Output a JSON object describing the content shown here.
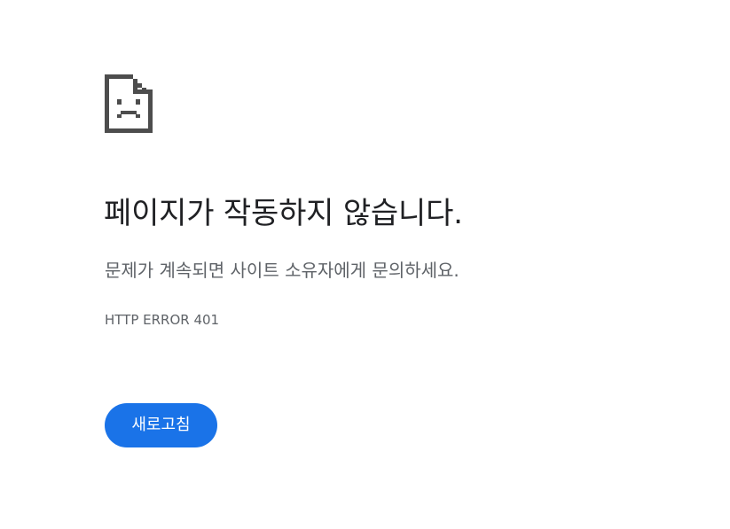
{
  "error_page": {
    "icon": "sad-page-icon",
    "title": "페이지가 작동하지 않습니다.",
    "message": "문제가 계속되면 사이트 소유자에게 문의하세요.",
    "error_code": "HTTP ERROR 401",
    "reload_label": "새로고침"
  },
  "colors": {
    "button": "#1a73e8",
    "title": "#202124",
    "body_text": "#5f6368",
    "icon": "#4d4d4d"
  }
}
